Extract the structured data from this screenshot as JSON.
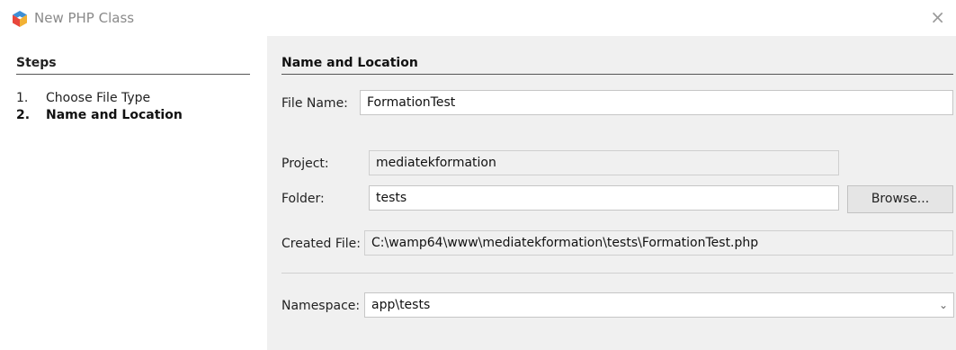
{
  "window": {
    "title": "New PHP Class",
    "close_symbol": "×",
    "app_icon": "netbeans-icon"
  },
  "steps": {
    "heading": "Steps",
    "items": [
      {
        "number": "1.",
        "label": "Choose File Type",
        "current": false
      },
      {
        "number": "2.",
        "label": "Name and Location",
        "current": true
      }
    ]
  },
  "panel": {
    "heading": "Name and Location",
    "file_name": {
      "label": "File Name:",
      "value": "FormationTest"
    },
    "project": {
      "label": "Project:",
      "value": "mediatekformation"
    },
    "folder": {
      "label": "Folder:",
      "value": "tests",
      "browse_label": "Browse..."
    },
    "created_file": {
      "label": "Created File:",
      "value": "C:\\wamp64\\www\\mediatekformation\\tests\\FormationTest.php"
    },
    "namespace": {
      "label": "Namespace:",
      "value": "app\\tests",
      "dropdown_icon": "chevron-down-icon"
    }
  }
}
